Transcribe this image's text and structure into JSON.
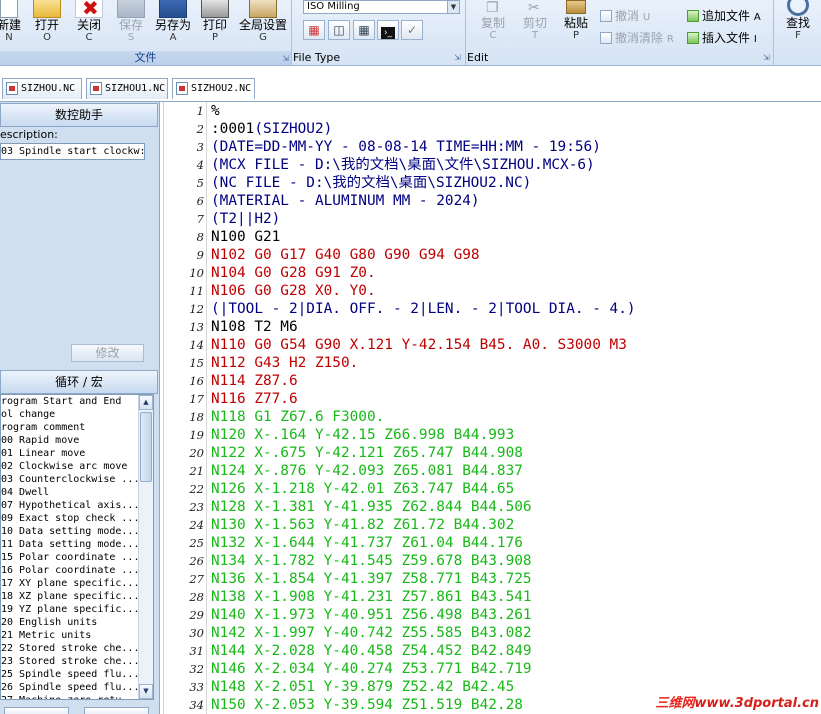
{
  "ribbon": {
    "file_group": {
      "label": "文件",
      "buttons": [
        {
          "label": "新建",
          "key": "N",
          "icon": "new-file-icon",
          "disabled": false
        },
        {
          "label": "打开",
          "key": "O",
          "icon": "open-folder-icon",
          "disabled": false
        },
        {
          "label": "关闭",
          "key": "C",
          "icon": "close-icon",
          "disabled": false
        },
        {
          "label": "保存",
          "key": "S",
          "icon": "save-icon",
          "disabled": true
        },
        {
          "label": "另存为",
          "key": "A",
          "icon": "save-as-icon",
          "disabled": false
        },
        {
          "label": "打印",
          "key": "P",
          "icon": "printer-icon",
          "disabled": false
        },
        {
          "label": "全局设置",
          "key": "G",
          "icon": "settings-icon",
          "disabled": false
        }
      ]
    },
    "file_type_group": {
      "label": "File Type",
      "selected": "ISO Milling"
    },
    "edit_group": {
      "label": "Edit",
      "copy": {
        "label": "复制",
        "key": "C"
      },
      "cut": {
        "label": "剪切",
        "key": "T"
      },
      "paste": {
        "label": "粘贴",
        "key": "P"
      },
      "undo": {
        "label": "撤消",
        "key": "U"
      },
      "undo_clear": {
        "label": "撤消清除",
        "key": "R"
      },
      "append_file": {
        "label": "追加文件",
        "key": "A"
      },
      "insert_file": {
        "label": "插入文件",
        "key": "I"
      }
    },
    "find": {
      "label": "查找",
      "key": "F"
    }
  },
  "tabs": [
    {
      "label": "SIZHOU.NC",
      "active": false
    },
    {
      "label": "SIZHOU1.NC",
      "active": false
    },
    {
      "label": "SIZHOU2.NC",
      "active": true
    }
  ],
  "left_panel": {
    "assistant_title": "数控助手",
    "description_label": "escription:",
    "description_value": "03 Spindle start clockw:",
    "modify_label": "修改",
    "cycles_title": "循环 / 宏",
    "cycle_items": [
      "rogram Start and End",
      "ol change",
      "rogram comment",
      "00 Rapid move",
      "01 Linear move",
      "02 Clockwise arc move",
      "03 Counterclockwise ...",
      "04 Dwell",
      "07 Hypothetical axis...",
      "09 Exact stop check ...",
      "10 Data setting mode...",
      "11 Data setting mode...",
      "15 Polar coordinate ...",
      "16 Polar coordinate ...",
      "17 XY plane specific...",
      "18 XZ plane specific...",
      "19 YZ plane specific...",
      "20 English units",
      "21 Metric units",
      "22 Stored stroke che...",
      "23 Stored stroke che...",
      "25 Spindle speed flu...",
      "26 Spindle speed flu...",
      "27 Machine zero retu..."
    ]
  },
  "editor": {
    "colors": {
      "black": "#000000",
      "blue": "#000080",
      "red": "#c00000",
      "green": "#18b818"
    },
    "lines": [
      {
        "n": "1",
        "text": "%",
        "color": "black"
      },
      {
        "n": "2",
        "text": ":0001(SIZHOU2)",
        "color": "mixed"
      },
      {
        "n": "3",
        "text": "(DATE=DD-MM-YY - 08-08-14 TIME=HH:MM - 19:56)",
        "color": "blue"
      },
      {
        "n": "4",
        "text": "(MCX FILE - D:\\我的文档\\桌面\\文件\\SIZHOU.MCX-6)",
        "color": "blue"
      },
      {
        "n": "5",
        "text": "(NC FILE - D:\\我的文档\\桌面\\SIZHOU2.NC)",
        "color": "blue"
      },
      {
        "n": "6",
        "text": "(MATERIAL - ALUMINUM MM - 2024)",
        "color": "blue"
      },
      {
        "n": "7",
        "text": "(T2||H2)",
        "color": "blue"
      },
      {
        "n": "8",
        "text": "N100 G21",
        "color": "black"
      },
      {
        "n": "9",
        "text": "N102 G0 G17 G40 G80 G90 G94 G98",
        "color": "red"
      },
      {
        "n": "10",
        "text": "N104 G0 G28 G91 Z0.",
        "color": "red"
      },
      {
        "n": "11",
        "text": "N106 G0 G28 X0. Y0.",
        "color": "red"
      },
      {
        "n": "12",
        "text": "(|TOOL - 2|DIA. OFF. - 2|LEN. - 2|TOOL DIA. - 4.)",
        "color": "blue"
      },
      {
        "n": "13",
        "text": "N108 T2 M6",
        "color": "black"
      },
      {
        "n": "14",
        "text": "N110 G0 G54 G90 X.121 Y-42.154 B45. A0. S3000 M3",
        "color": "red"
      },
      {
        "n": "15",
        "text": "N112 G43 H2 Z150.",
        "color": "red"
      },
      {
        "n": "16",
        "text": "N114 Z87.6",
        "color": "red"
      },
      {
        "n": "17",
        "text": "N116 Z77.6",
        "color": "red"
      },
      {
        "n": "18",
        "text": "N118 G1 Z67.6 F3000.",
        "color": "green"
      },
      {
        "n": "19",
        "text": "N120 X-.164 Y-42.15 Z66.998 B44.993",
        "color": "green"
      },
      {
        "n": "20",
        "text": "N122 X-.675 Y-42.121 Z65.747 B44.908",
        "color": "green"
      },
      {
        "n": "21",
        "text": "N124 X-.876 Y-42.093 Z65.081 B44.837",
        "color": "green"
      },
      {
        "n": "22",
        "text": "N126 X-1.218 Y-42.01 Z63.747 B44.65",
        "color": "green"
      },
      {
        "n": "23",
        "text": "N128 X-1.381 Y-41.935 Z62.844 B44.506",
        "color": "green"
      },
      {
        "n": "24",
        "text": "N130 X-1.563 Y-41.82 Z61.72 B44.302",
        "color": "green"
      },
      {
        "n": "25",
        "text": "N132 X-1.644 Y-41.737 Z61.04 B44.176",
        "color": "green"
      },
      {
        "n": "26",
        "text": "N134 X-1.782 Y-41.545 Z59.678 B43.908",
        "color": "green"
      },
      {
        "n": "27",
        "text": "N136 X-1.854 Y-41.397 Z58.771 B43.725",
        "color": "green"
      },
      {
        "n": "28",
        "text": "N138 X-1.908 Y-41.231 Z57.861 B43.541",
        "color": "green"
      },
      {
        "n": "29",
        "text": "N140 X-1.973 Y-40.951 Z56.498 B43.261",
        "color": "green"
      },
      {
        "n": "30",
        "text": "N142 X-1.997 Y-40.742 Z55.585 B43.082",
        "color": "green"
      },
      {
        "n": "31",
        "text": "N144 X-2.028 Y-40.458 Z54.452 B42.849",
        "color": "green"
      },
      {
        "n": "32",
        "text": "N146 X-2.034 Y-40.274 Z53.771 B42.719",
        "color": "green"
      },
      {
        "n": "33",
        "text": "N148 X-2.051 Y-39.879 Z52.42 B42.45",
        "color": "green"
      },
      {
        "n": "34",
        "text": "N150 X-2.053 Y-39.594 Z51.519 B42.28",
        "color": "green"
      }
    ],
    "line2_parts": {
      "prefix": ":0001",
      "comment": "(SIZHOU2)"
    }
  },
  "watermark": {
    "part1": "三维网",
    "part2": "www.3dportal.cn",
    "color1": "#e8241c",
    "color2": "#d6201a"
  }
}
